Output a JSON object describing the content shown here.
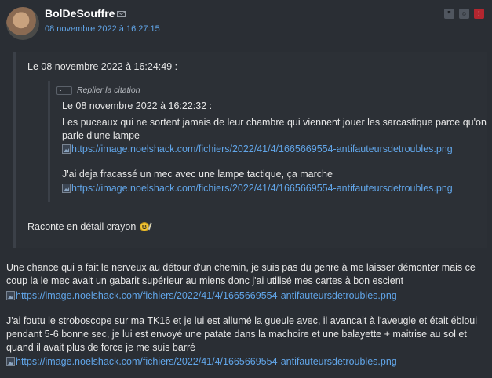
{
  "post": {
    "author": "BolDeSouffre",
    "date": "08 novembre 2022 à 16:27:15",
    "quote_outer": {
      "date": "Le 08 novembre 2022 à 16:24:49 :",
      "reply_label": "Replier la citation",
      "quote_inner": {
        "date": "Le 08 novembre 2022 à 16:22:32 :",
        "text1": "Les puceaux qui ne sortent jamais de leur chambre qui viennent jouer les sarcastique parce qu'on parle d'une lampe",
        "link1": "https://image.noelshack.com/fichiers/2022/41/4/1665669554-antifauteursdetroubles.png",
        "text2": "J'ai deja fracassé un mec avec une lampe tactique, ça marche",
        "link2": "https://image.noelshack.com/fichiers/2022/41/4/1665669554-antifauteursdetroubles.png"
      },
      "text": "Raconte en détail crayon"
    },
    "paragraph1": "Une chance qui a fait le nerveux au détour d'un chemin, je suis pas du genre à me laisser démonter mais ce coup la le mec avait un gabarit supérieur au miens donc j'ai utilisé mes cartes à bon escient",
    "link1": "https://image.noelshack.com/fichiers/2022/41/4/1665669554-antifauteursdetroubles.png",
    "paragraph2": "J'ai foutu le stroboscope sur ma TK16 et je lui est allumé la gueule avec, il avancait à l'aveugle et était ébloui pendant 5-6 bonne sec, je lui est envoyé une patate dans la machoire et une balayette + maitrise au sol et quand il avait plus de force je me suis barré",
    "link2": "https://image.noelshack.com/fichiers/2022/41/4/1665669554-antifauteursdetroubles.png"
  },
  "icons": [
    "avatar",
    "mail-icon",
    "quote-icon",
    "mp-icon",
    "alert-icon",
    "image-icon",
    "smiley-icon"
  ],
  "colors": {
    "background": "#2a2e34",
    "link": "#61a5e8",
    "alert": "#b3262f"
  }
}
